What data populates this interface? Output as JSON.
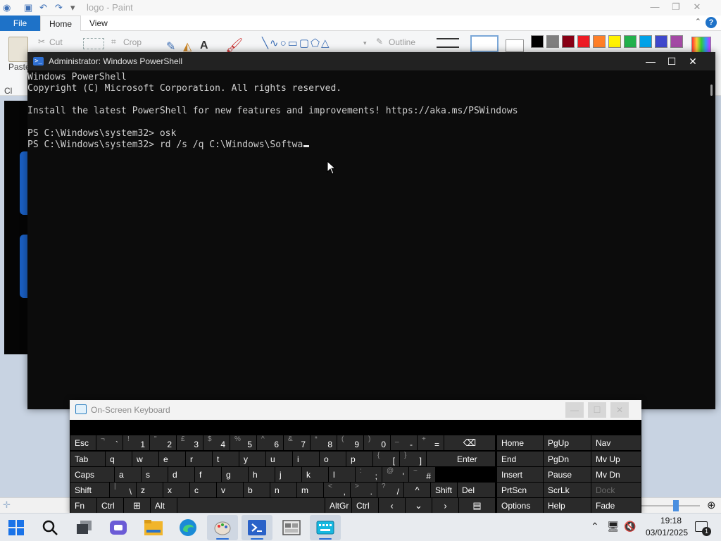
{
  "paint": {
    "title": "logo - Paint",
    "tabs": {
      "file": "File",
      "home": "Home",
      "view": "View"
    },
    "ribbon": {
      "paste": "Paste",
      "cut": "Cut",
      "crop": "Crop",
      "outline": "Outline",
      "clipboard_fragment": "Cl"
    },
    "colors": [
      "#000000",
      "#7f7f7f",
      "#880015",
      "#ed1c24",
      "#ff7f27",
      "#fff200",
      "#22b14c",
      "#00a2e8",
      "#3f48cc",
      "#a349a4"
    ]
  },
  "powershell": {
    "title": "Administrator: Windows PowerShell",
    "lines": [
      "Windows PowerShell",
      "Copyright (C) Microsoft Corporation. All rights reserved.",
      "",
      "Install the latest PowerShell for new features and improvements! https://aka.ms/PSWindows",
      "",
      "PS C:\\Windows\\system32> osk",
      "PS C:\\Windows\\system32> rd /s /q C:\\Windows\\Softwa"
    ],
    "controls": {
      "minimize": "—",
      "maximize": "☐",
      "close": "✕"
    }
  },
  "osk": {
    "title": "On-Screen Keyboard",
    "row1": [
      {
        "lbl": "Esc"
      },
      {
        "sub": "¬",
        "main": "`"
      },
      {
        "sub": "!",
        "main": "1"
      },
      {
        "sub": "\"",
        "main": "2"
      },
      {
        "sub": "£",
        "main": "3"
      },
      {
        "sub": "$",
        "main": "4"
      },
      {
        "sub": "%",
        "main": "5"
      },
      {
        "sub": "^",
        "main": "6"
      },
      {
        "sub": "&",
        "main": "7"
      },
      {
        "sub": "*",
        "main": "8"
      },
      {
        "sub": "(",
        "main": "9"
      },
      {
        "sub": ")",
        "main": "0"
      },
      {
        "sub": "_",
        "main": "-"
      },
      {
        "sub": "+",
        "main": "="
      },
      {
        "icon": "⌫"
      }
    ],
    "row2": [
      "Tab",
      "q",
      "w",
      "e",
      "r",
      "t",
      "y",
      "u",
      "i",
      "o",
      "p"
    ],
    "row2_brackets": [
      {
        "sub": "{",
        "main": "["
      },
      {
        "sub": "}",
        "main": "]"
      }
    ],
    "enter": "Enter",
    "row3": [
      "Caps",
      "a",
      "s",
      "d",
      "f",
      "g",
      "h",
      "j",
      "k",
      "l"
    ],
    "row3_punct": [
      {
        "sub": ":",
        "main": ";"
      },
      {
        "sub": "@",
        "main": "'"
      },
      {
        "sub": "~",
        "main": "#"
      }
    ],
    "row4_left": "Shift",
    "row4": [
      {
        "sub": "|",
        "main": "\\"
      },
      {
        "main": "z"
      },
      {
        "main": "x"
      },
      {
        "main": "c"
      },
      {
        "main": "v"
      },
      {
        "main": "b"
      },
      {
        "main": "n"
      },
      {
        "main": "m"
      },
      {
        "sub": "<",
        "main": ","
      },
      {
        "sub": ">",
        "main": "."
      },
      {
        "sub": "?",
        "main": "/"
      }
    ],
    "row4_right": {
      "up": "^",
      "shift": "Shift",
      "del": "Del"
    },
    "row5": {
      "fn": "Fn",
      "ctrl": "Ctrl",
      "alt": "Alt",
      "altgr": "AltGr",
      "ctrl2": "Ctrl"
    },
    "nav_keys": [
      [
        "Home",
        "PgUp",
        "Nav"
      ],
      [
        "End",
        "PgDn",
        "Mv Up"
      ],
      [
        "Insert",
        "Pause",
        "Mv Dn"
      ],
      [
        "PrtScn",
        "ScrLk",
        "Dock"
      ],
      [
        "Options",
        "Help",
        "Fade"
      ]
    ]
  },
  "taskbar": {
    "items": [
      "start-icon",
      "search-icon",
      "task-view-icon",
      "teams-icon",
      "file-explorer-icon",
      "edge-icon",
      "paint-icon",
      "powershell-icon",
      "virtual-machine-icon",
      "on-screen-keyboard-icon"
    ],
    "time": "19:18",
    "date": "03/01/2025",
    "notification_count": "1"
  }
}
